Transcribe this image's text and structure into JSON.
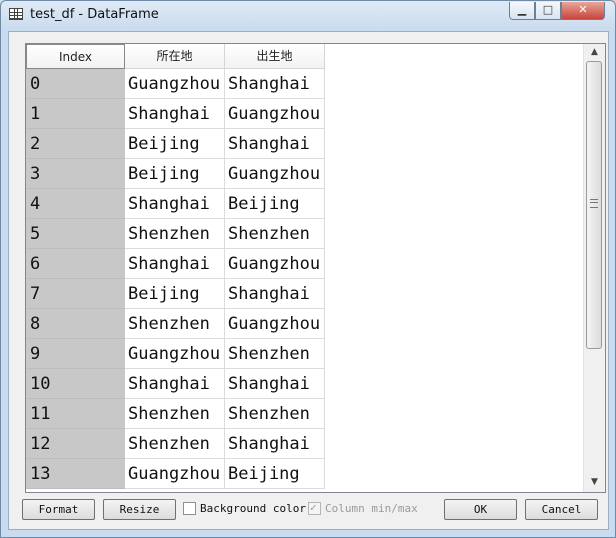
{
  "window": {
    "title": "test_df - DataFrame",
    "controls": {
      "minimize": "▁",
      "maximize": "□",
      "close": "✕"
    }
  },
  "table": {
    "headers": [
      "Index",
      "所在地",
      "出生地"
    ],
    "rows": [
      {
        "index": "0",
        "location": "Guangzhou",
        "birthplace": "Shanghai"
      },
      {
        "index": "1",
        "location": "Shanghai",
        "birthplace": "Guangzhou"
      },
      {
        "index": "2",
        "location": "Beijing",
        "birthplace": "Shanghai"
      },
      {
        "index": "3",
        "location": "Beijing",
        "birthplace": "Guangzhou"
      },
      {
        "index": "4",
        "location": "Shanghai",
        "birthplace": "Beijing"
      },
      {
        "index": "5",
        "location": "Shenzhen",
        "birthplace": "Shenzhen"
      },
      {
        "index": "6",
        "location": "Shanghai",
        "birthplace": "Guangzhou"
      },
      {
        "index": "7",
        "location": "Beijing",
        "birthplace": "Shanghai"
      },
      {
        "index": "8",
        "location": "Shenzhen",
        "birthplace": "Guangzhou"
      },
      {
        "index": "9",
        "location": "Guangzhou",
        "birthplace": "Shenzhen"
      },
      {
        "index": "10",
        "location": "Shanghai",
        "birthplace": "Shanghai"
      },
      {
        "index": "11",
        "location": "Shenzhen",
        "birthplace": "Shenzhen"
      },
      {
        "index": "12",
        "location": "Shenzhen",
        "birthplace": "Shanghai"
      },
      {
        "index": "13",
        "location": "Guangzhou",
        "birthplace": "Beijing"
      }
    ]
  },
  "scrollbar": {
    "up_icon": "▲",
    "down_icon": "▼"
  },
  "buttons": {
    "format": "Format",
    "resize": "Resize",
    "ok": "OK",
    "cancel": "Cancel"
  },
  "checkboxes": {
    "background_color": {
      "label": "Background color",
      "checked": false
    },
    "column_minmax": {
      "label": "Column min/max",
      "checked": true,
      "enabled": false
    }
  }
}
